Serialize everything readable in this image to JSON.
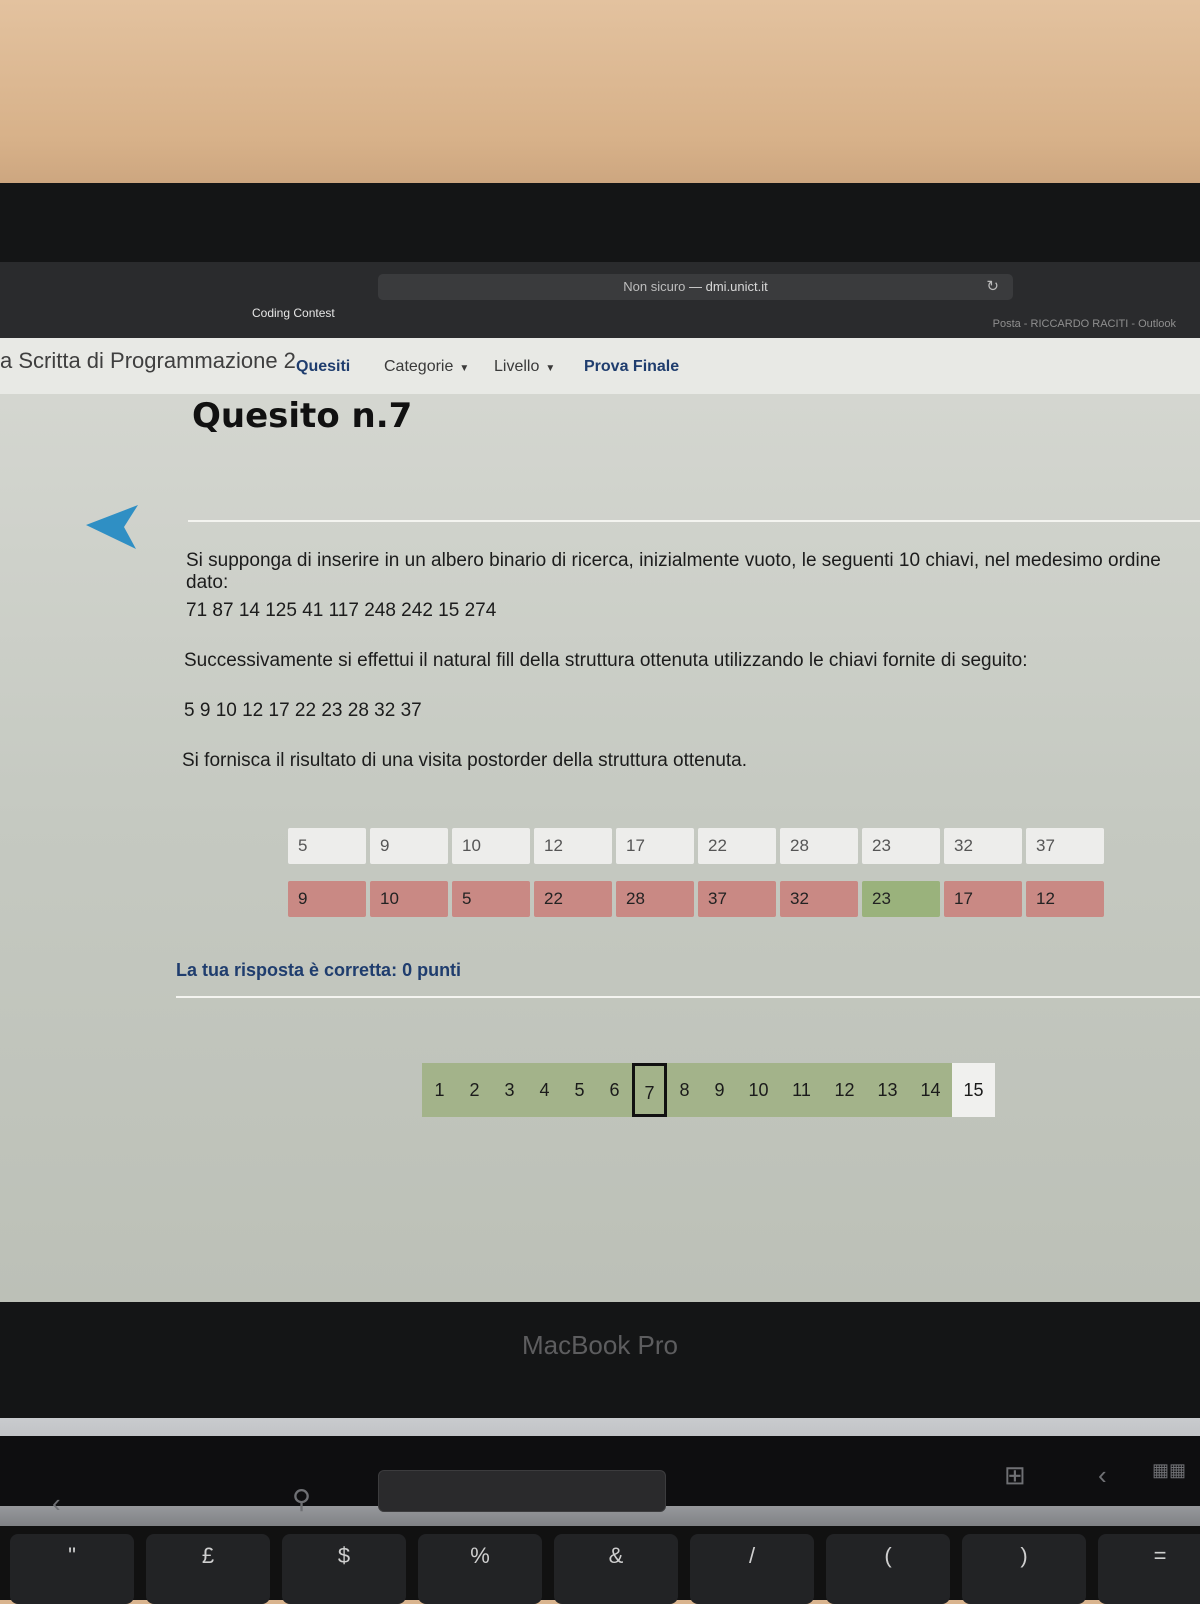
{
  "browser": {
    "url_security": "Non sicuro",
    "url_separator": "—",
    "url_domain": "dmi.unict.it",
    "tab_left": "Coding Contest",
    "tab_right": "Posta - RICCARDO RACITI - Outlook"
  },
  "navbar": {
    "brand": "a Scritta di Programmazione 2",
    "items": [
      {
        "label": "Quesiti"
      },
      {
        "label": "Categorie"
      },
      {
        "label": "Livello"
      },
      {
        "label": "Prova Finale"
      }
    ]
  },
  "question": {
    "title": "Quesito n.7",
    "line1": "Si supponga di inserire in un albero binario di ricerca, inizialmente vuoto, le seguenti 10 chiavi, nel medesimo ordine dato:",
    "keys1": "71 87 14 125 41 117 248 242 15 274",
    "line2": "Successivamente si effettui il natural fill della struttura ottenuta utilizzando le chiavi fornite di seguito:",
    "keys2": "5 9 10 12 17 22 23 28 32 37",
    "line3": "Si fornisca il risultato di una visita postorder della struttura ottenuta."
  },
  "answer_row": [
    "5",
    "9",
    "10",
    "12",
    "17",
    "22",
    "28",
    "23",
    "32",
    "37"
  ],
  "solution_row": [
    {
      "value": "9",
      "status": "wrong"
    },
    {
      "value": "10",
      "status": "wrong"
    },
    {
      "value": "5",
      "status": "wrong"
    },
    {
      "value": "22",
      "status": "wrong"
    },
    {
      "value": "28",
      "status": "wrong"
    },
    {
      "value": "37",
      "status": "wrong"
    },
    {
      "value": "32",
      "status": "wrong"
    },
    {
      "value": "23",
      "status": "correct"
    },
    {
      "value": "17",
      "status": "wrong"
    },
    {
      "value": "12",
      "status": "wrong"
    }
  ],
  "feedback": "La tua risposta è corretta: 0 punti",
  "pager": [
    "1",
    "2",
    "3",
    "4",
    "5",
    "6",
    "7",
    "8",
    "9",
    "10",
    "11",
    "12",
    "13",
    "14",
    "15"
  ],
  "pager_current": "7",
  "laptop_label": "MacBook Pro",
  "keyboard_symbols": [
    "\"",
    "£",
    "$",
    "%",
    "&",
    "/",
    "(",
    ")",
    "="
  ],
  "colors": {
    "accent": "#2f8fc4",
    "wrong": "#c98984",
    "correct": "#9ab27c",
    "pager": "#a3b38a"
  }
}
